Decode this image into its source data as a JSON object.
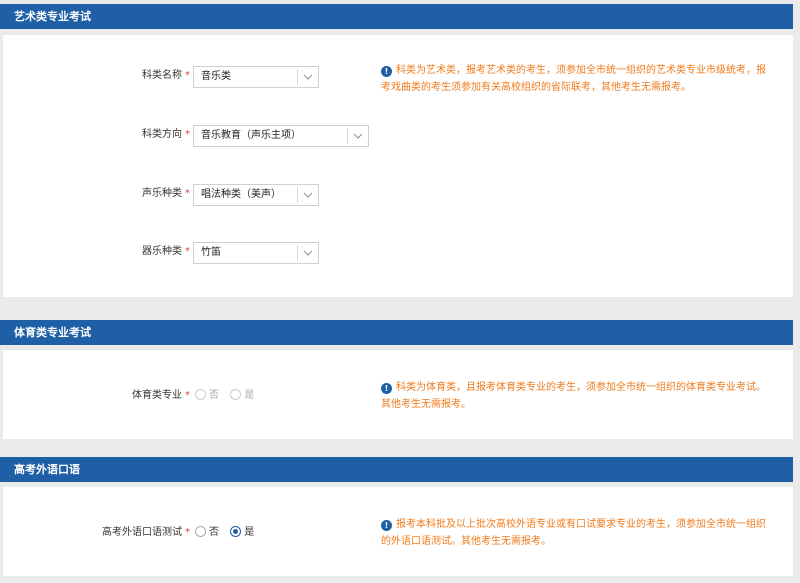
{
  "art": {
    "title": "艺术类专业考试",
    "fields": [
      {
        "label": "科类名称",
        "value": "音乐类"
      },
      {
        "label": "科类方向",
        "value": "音乐教育（声乐主项）"
      },
      {
        "label": "声乐种类",
        "value": "唱法种类（美声）"
      },
      {
        "label": "器乐种类",
        "value": "竹笛"
      }
    ],
    "required_mark": "*",
    "hint_line1": "科类为艺术类，报考艺术类的考生，须参加全市统一组织的艺术类专业市级统考，报",
    "hint_line2": "考戏曲类的考生须参加有关高校组织的省际联考，其他考生无需报考。"
  },
  "sports": {
    "title": "体育类专业考试",
    "field_label": "体育类专业",
    "required_mark": "*",
    "options": [
      "否",
      "是"
    ],
    "selected": null,
    "hint_line1": "科类为体育类，且报考体育类专业的考生，须参加全市统一组织的体育类专业考试。",
    "hint_line2": "其他考生无需报考。"
  },
  "oral": {
    "title": "高考外语口语",
    "field_label": "高考外语口语测试",
    "required_mark": "*",
    "options": [
      "否",
      "是"
    ],
    "selected": "是",
    "hint_line1": "报考本科批及以上批次高校外语专业或有口试要求专业的考生，须参加全市统一组织",
    "hint_line2": "的外语口语测试。其他考生无需报考。"
  },
  "colors": {
    "header_bar": "#1f5fa6",
    "hint_text": "#f07a1b",
    "required": "#e03a3a"
  }
}
